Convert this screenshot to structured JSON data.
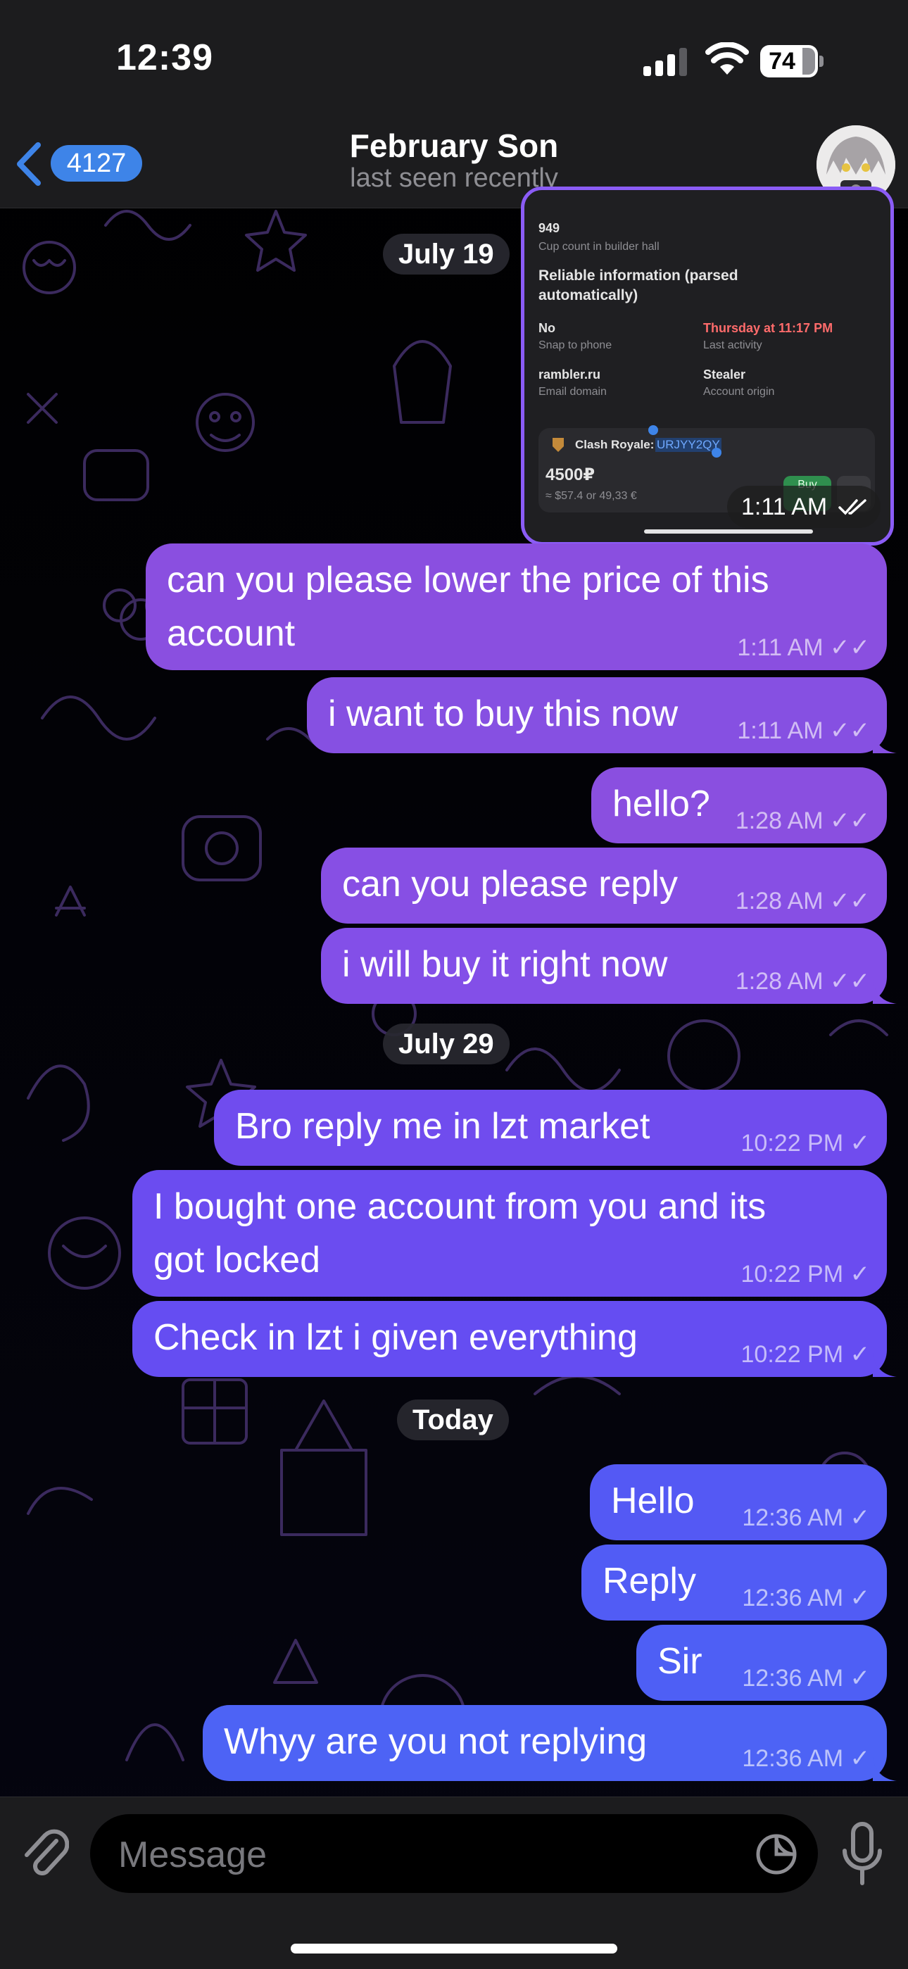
{
  "status_bar": {
    "time": "12:39",
    "battery": "74"
  },
  "header": {
    "back_count": "4127",
    "title": "February Son",
    "subtitle": "last seen recently"
  },
  "media": {
    "cup_value": "949",
    "cup_label": "Cup count in builder hall",
    "section": "Reliable information (parsed automatically)",
    "snap_value": "No",
    "snap_label": "Snap to phone",
    "activity_value": "Thursday at 11:17 PM",
    "activity_label": "Last activity",
    "email_value": "rambler.ru",
    "email_label": "Email domain",
    "origin_value": "Stealer",
    "origin_label": "Account origin",
    "game_label": "Clash Royale:",
    "game_tag": "URJYY2QY",
    "price": "4500₽",
    "price_sub": "≈ $57.4 or 49,33 €",
    "buy_label": "Buy",
    "time": "1:11 AM"
  },
  "dates": {
    "d1": "July 19",
    "d2": "July 29",
    "d3": "Today"
  },
  "messages": [
    {
      "text_1": "can you please lower the price of this",
      "text_2": "account",
      "time": "1:11 AM"
    },
    {
      "text": "i want to buy this now",
      "time": "1:11 AM"
    },
    {
      "text": "hello?",
      "time": "1:28 AM"
    },
    {
      "text": "can you please reply",
      "time": "1:28 AM"
    },
    {
      "text": "i will buy it right now",
      "time": "1:28 AM"
    },
    {
      "text": "Bro reply me in lzt market",
      "time": "10:22 PM"
    },
    {
      "text_1": "I bought one account from you and its",
      "text_2": "got locked",
      "time": "10:22 PM"
    },
    {
      "text": "Check in lzt i given everything",
      "time": "10:22 PM"
    },
    {
      "text": "Hello",
      "time": "12:36 AM"
    },
    {
      "text": "Reply",
      "time": "12:36 AM"
    },
    {
      "text": "Sir",
      "time": "12:36 AM"
    },
    {
      "text": "Whyy are you not replying",
      "time": "12:36 AM"
    }
  ],
  "input": {
    "placeholder": "Message"
  },
  "colors": {
    "bubble_top": "#8a4fe0",
    "bubble_mid": "#6b4cf0",
    "bubble_bottom": "#4d63f5",
    "accent": "#3e84e8"
  }
}
